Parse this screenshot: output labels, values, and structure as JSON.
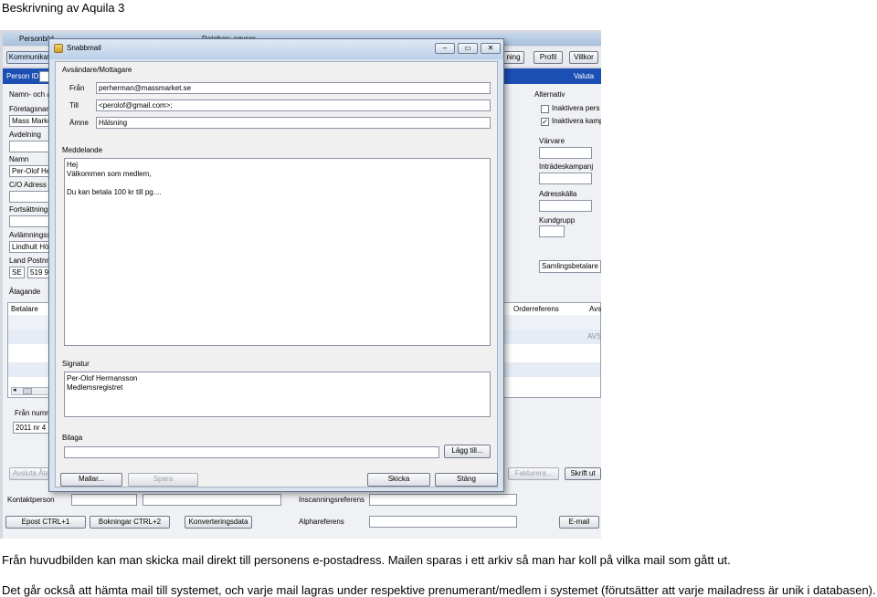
{
  "document": {
    "heading": "Beskrivning av Aquila 3",
    "paragraph1": "Från huvudbilden kan man skicka mail direkt till personens e-postadress. Mailen sparas i ett arkiv så man har koll på vilka mail som gått ut.",
    "paragraph2": "Det går också att hämta mail till systemet, och varje mail lagras under respektive  prenumerant/medlem i systemet (förutsätter att varje mailadress är unik i databasen)."
  },
  "main_window": {
    "title": "Personbild",
    "database_label": "Databas: aquser",
    "toolbar": [
      "Kommunikat",
      "ning",
      "Profil",
      "Villkor"
    ],
    "blue_bar": {
      "left": "Person ID",
      "right": "Valuta"
    },
    "left_labels": [
      "Namn- och a",
      "Företagsnam",
      "Avdelning",
      "Namn",
      "C/O Adress",
      "Fortsättnings",
      "Avlämningss",
      "Land  Postnr"
    ],
    "left_values": {
      "company": "Mass Marke",
      "name": "Per-Olof Her",
      "delivery": "Lindhult Höj",
      "country": "SE",
      "postcode": "519 9"
    },
    "section_commitment": "Åtagande",
    "list_headers": [
      "Betalare",
      "Orderreferens",
      "Avs"
    ],
    "list_row_value": "AVS",
    "from_number_label": "Från numm",
    "from_number_value": "2011 nr 4",
    "right_panel": {
      "group": "Alternativ",
      "checkbox1": "Inaktivera pers",
      "checkbox2": "Inaktivera kamp",
      "checkbox2_checked": true,
      "labels": [
        "Värvare",
        "Inträdeskampanj",
        "Adresskälla",
        "Kundgrupp"
      ],
      "payment": "Samlingsbetalare"
    },
    "bottom": {
      "left_disabled": "Avsluta Åta",
      "invoice": "Fakturera...",
      "print": "Skrift ut",
      "contact_label": "Kontaktperson",
      "scan_label": "Inscanningsreferens",
      "alpha_label": "Alphareferens",
      "btn_email": "Epost CTRL+1",
      "btn_bookings": "Bokningar CTRL+2",
      "btn_convert": "Konverteringsdata",
      "btn_mail": "E-mail"
    }
  },
  "dialog": {
    "title": "Snabbmail",
    "sender_group": "Avsändare/Mottagare",
    "from_label": "Från",
    "from_value": "perherman@massmarket.se",
    "to_label": "Till",
    "to_value": "<perolof@gmail.com>;",
    "subject_label": "Ämne",
    "subject_value": "Hälsning",
    "message_group": "Meddelande",
    "message_text": "Hej\nVälkommen som medlem,\n\nDu kan betala 100 kr till pg....",
    "signature_group": "Signatur",
    "signature_text": "Per-Olof Hermansson\nMedlemsregistret",
    "attachment_group": "Bilaga",
    "add_button": "Lägg till...",
    "template_button": "Mallar...",
    "save_button": "Spara",
    "send_button": "Skicka",
    "close_button": "Stäng",
    "window_controls": [
      "–",
      "▭",
      "✕"
    ]
  }
}
